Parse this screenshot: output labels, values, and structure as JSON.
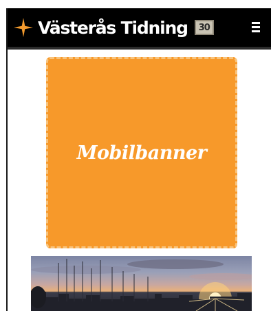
{
  "header": {
    "logo_text": "Västerås Tidning",
    "badge_text": "30",
    "menu_icon": "hamburger-menu-icon",
    "background": "#000000"
  },
  "banner": {
    "label": "Mobilbanner",
    "color": "#f7992a",
    "border_color": "#f8c47e"
  },
  "photo": {
    "subject": "harbor-sunset-sailboats"
  },
  "colors": {
    "logo_star": "#f29a2e",
    "text_light": "#ffffff"
  }
}
